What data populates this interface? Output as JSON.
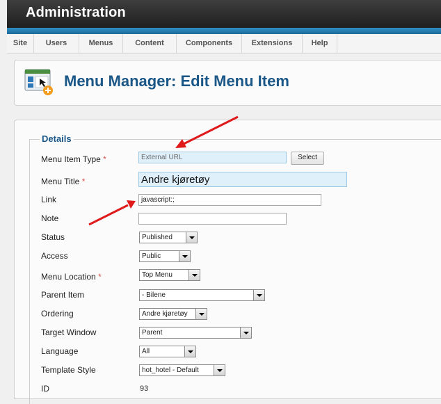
{
  "app": {
    "title": "Administration"
  },
  "menu": {
    "items": [
      {
        "label": "Site"
      },
      {
        "label": "Users"
      },
      {
        "label": "Menus"
      },
      {
        "label": "Content"
      },
      {
        "label": "Components"
      },
      {
        "label": "Extensions"
      },
      {
        "label": "Help"
      }
    ]
  },
  "page": {
    "title": "Menu Manager: Edit Menu Item",
    "icon": "menu-manager-icon"
  },
  "form": {
    "legend": "Details",
    "required_marker": "*",
    "menu_item_type": {
      "label": "Menu Item Type",
      "value": "External URL",
      "button": "Select"
    },
    "menu_title": {
      "label": "Menu Title",
      "value": "Andre kjøretøy"
    },
    "link": {
      "label": "Link",
      "value": "javascript:;"
    },
    "note": {
      "label": "Note",
      "value": ""
    },
    "status": {
      "label": "Status",
      "value": "Published"
    },
    "access": {
      "label": "Access",
      "value": "Public"
    },
    "menu_location": {
      "label": "Menu Location",
      "value": "Top Menu"
    },
    "parent_item": {
      "label": "Parent Item",
      "value": "- Bilene"
    },
    "ordering": {
      "label": "Ordering",
      "value": "Andre kjøretøy"
    },
    "target_window": {
      "label": "Target Window",
      "value": "Parent"
    },
    "language": {
      "label": "Language",
      "value": "All"
    },
    "template_style": {
      "label": "Template Style",
      "value": "hot_hotel - Default"
    },
    "id": {
      "label": "ID",
      "value": "93"
    }
  },
  "colors": {
    "accent": "#1b5787",
    "annotation_arrow": "#e0191b",
    "required": "#d9534f"
  }
}
